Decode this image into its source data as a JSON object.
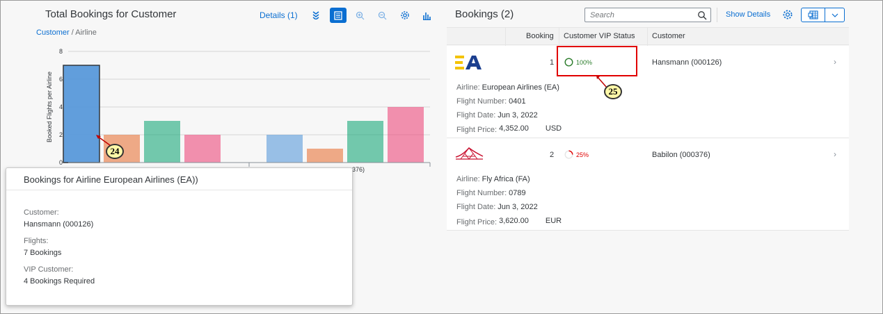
{
  "left": {
    "title": "Total Bookings for Customer",
    "details_link": "Details (1)",
    "breadcrumb_link": "Customer",
    "breadcrumb_sep": " / ",
    "breadcrumb_current": "Airline"
  },
  "chart_data": {
    "type": "bar",
    "ylabel": "Booked Flights per Airline",
    "ylim": [
      0,
      8
    ],
    "yticks": [
      "0",
      "2",
      "4",
      "6",
      "8"
    ],
    "groups": [
      {
        "label": "Hansmann (000126)",
        "values": [
          7,
          2,
          3,
          2
        ],
        "colors": [
          "#5899da",
          "#e8743b",
          "#19a979",
          "#ed4a7b"
        ]
      },
      {
        "label": "Babilon (000376)",
        "values": [
          2,
          1,
          3,
          4
        ],
        "colors": [
          "#5899da",
          "#e8743b",
          "#19a979",
          "#ed4a7b"
        ]
      }
    ],
    "visible_tick_fragment": "376)"
  },
  "callouts": {
    "a": "24",
    "b": "25"
  },
  "popover": {
    "title": "Bookings for Airline European Airlines (EA))",
    "customer_label": "Customer:",
    "customer_value": "Hansmann (000126)",
    "flights_label": "Flights:",
    "flights_value": "7 Bookings",
    "vip_label": "VIP Customer:",
    "vip_value": "4 Bookings Required"
  },
  "right": {
    "title": "Bookings (2)",
    "search_placeholder": "Search",
    "show_details": "Show Details",
    "columns": [
      "Booking",
      "Customer VIP Status",
      "Customer"
    ],
    "rows": [
      {
        "booking": "1",
        "vip": "100%",
        "vip_fraction": 1.0,
        "vip_color": "#2b7d2b",
        "customer": "Hansmann (000126)",
        "airline_label": "Airline:",
        "airline": "European Airlines (EA)",
        "flight_number_label": "Flight Number:",
        "flight_number": "0401",
        "flight_date_label": "Flight Date:",
        "flight_date": "Jun 3, 2022",
        "price_label": "Flight Price:",
        "price": "4,352.00",
        "currency": "USD"
      },
      {
        "booking": "2",
        "vip": "25%",
        "vip_fraction": 0.25,
        "vip_color": "#e00000",
        "customer": "Babilon (000376)",
        "airline_label": "Airline:",
        "airline": "Fly Africa (FA)",
        "flight_number_label": "Flight Number:",
        "flight_number": "0789",
        "flight_date_label": "Flight Date:",
        "flight_date": "Jun 3, 2022",
        "price_label": "Flight Price:",
        "price": "3,620.00",
        "currency": "EUR"
      }
    ]
  }
}
